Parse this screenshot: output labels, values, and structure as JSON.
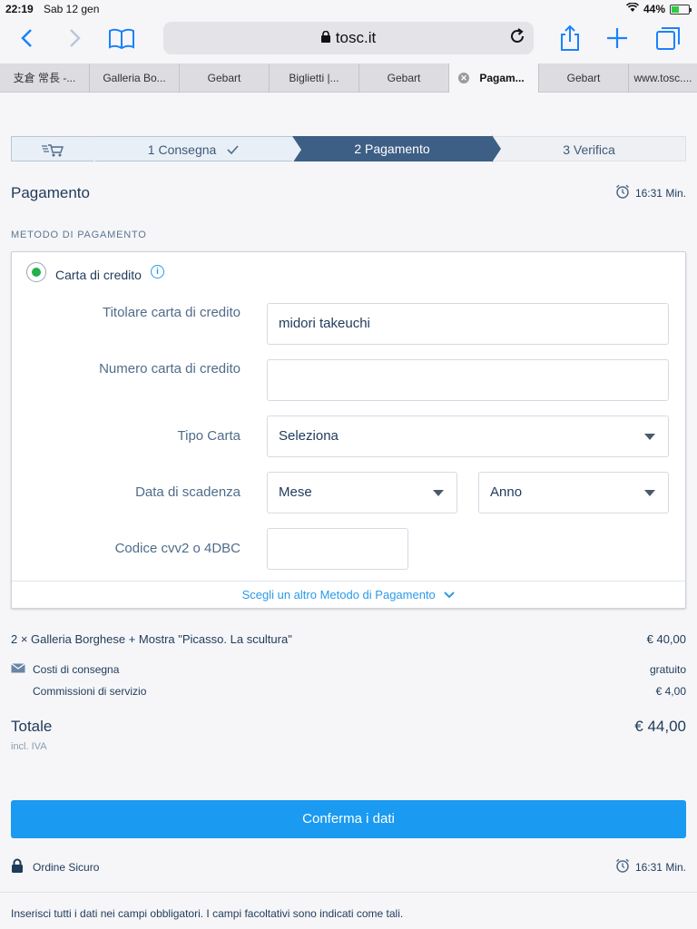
{
  "status": {
    "time": "22:19",
    "date": "Sab 12 gen",
    "battery_pct": "44%",
    "battery_level": 0.44
  },
  "browser": {
    "url": "tosc.it"
  },
  "tabs": [
    {
      "label": "支倉 常長 -..."
    },
    {
      "label": "Galleria Bo..."
    },
    {
      "label": "Gebart"
    },
    {
      "label": "Biglietti |..."
    },
    {
      "label": "Gebart"
    },
    {
      "label": "Pagam...",
      "active": true
    },
    {
      "label": "Gebart"
    },
    {
      "label": "www.tosc...."
    }
  ],
  "steps": {
    "step1": "1  Consegna",
    "step2": "2  Pagamento",
    "step3": "3  Verifica"
  },
  "page": {
    "title": "Pagamento",
    "timer": "16:31 Min.",
    "method_section": "METODO DI PAGAMENTO"
  },
  "payment": {
    "method": "Carta di credito",
    "fields": {
      "holder_label": "Titolare carta di credito",
      "holder_value": "midori takeuchi",
      "number_label": "Numero carta di credito",
      "number_value": "",
      "type_label": "Tipo Carta",
      "type_value": "Seleziona",
      "expiry_label": "Data di scadenza",
      "month_value": "Mese",
      "year_value": "Anno",
      "cvv_label": "Codice cvv2 o 4DBC",
      "cvv_value": ""
    },
    "other_method": "Scegli un altro Metodo di Pagamento"
  },
  "summary": {
    "item": "2 × Galleria Borghese + Mostra \"Picasso. La scultura\"",
    "item_price": "€ 40,00",
    "shipping_label": "Costi di consegna",
    "shipping_value": "gratuito",
    "fees_label": "Commissioni di servizio",
    "fees_value": "€ 4,00",
    "total_label": "Totale",
    "total_value": "€ 44,00",
    "tax_note": "incl. IVA"
  },
  "confirm_button": "Conferma i dati",
  "secure_label": "Ordine Sicuro",
  "footnote": "Inserisci tutti i dati nei campi obbligatori. I campi facoltativi sono indicati come tali.",
  "colors": {
    "accent": "#1a9af0",
    "step_active": "#3d5f85",
    "radio": "#22b14c"
  }
}
